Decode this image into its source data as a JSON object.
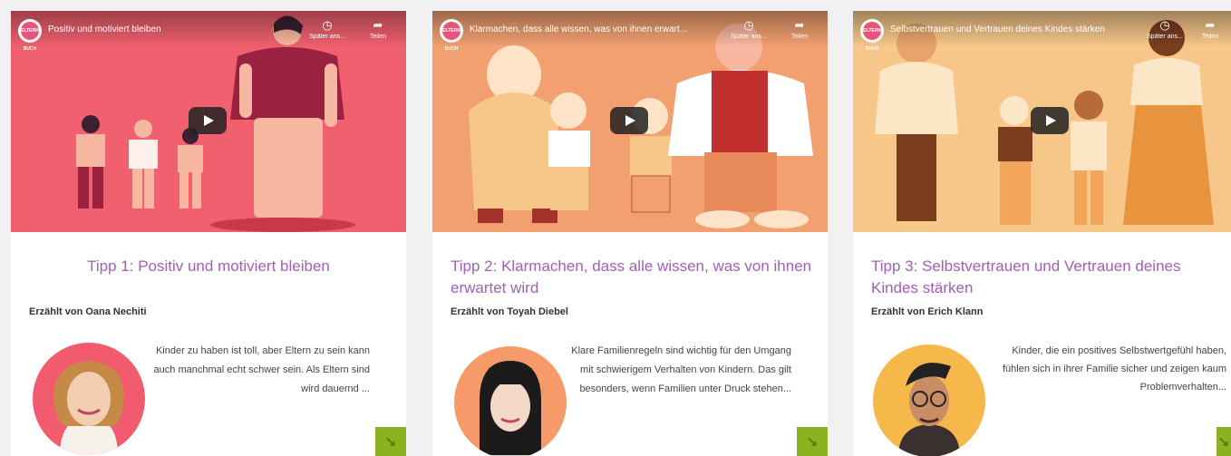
{
  "cards": [
    {
      "video": {
        "title": "Positiv und motiviert bleiben",
        "watch_later": "Später ans...",
        "share": "Teilen",
        "channel_badge": "ELTERN BUCH"
      },
      "title": "Tipp 1: Positiv und motiviert bleiben",
      "byline": "Erzählt von Oana Nechiti",
      "excerpt": "Kinder zu haben ist toll, aber Eltern zu sein kann auch manchmal echt schwer sein. Als Eltern sind wird dauernd ...",
      "colors": {
        "bg": "#f0606e",
        "avatar_bg": "#f25a6e"
      }
    },
    {
      "video": {
        "title": "Klarmachen, dass alle wissen, was von ihnen erwart...",
        "watch_later": "Später ans...",
        "share": "Teilen",
        "channel_badge": "ELTERN BUCH"
      },
      "title": "Tipp 2: Klarmachen, dass alle wissen, was von ihnen erwartet wird",
      "byline": "Erzählt von Toyah Diebel",
      "excerpt": "Klare Familienregeln sind wichtig für den Umgang mit schwierigem Verhalten von Kindern. Das gilt besonders, wenn Familien unter Druck stehen...",
      "colors": {
        "bg": "#f2a070",
        "avatar_bg": "#f79a6a"
      }
    },
    {
      "video": {
        "title": "Selbstvertrauen und Vertrauen deines Kindes stärken",
        "watch_later": "Später ans...",
        "share": "Teilen",
        "channel_badge": "ELTERN BUCH"
      },
      "title": "Tipp 3: Selbstvertrauen und Vertrauen deines Kindes stärken",
      "byline": "Erzählt von Erich Klann",
      "excerpt": "Kinder, die ein positives Selbstwertgefühl haben, fühlen sich in ihrer Familie sicher und zeigen kaum Problemverhalten...",
      "colors": {
        "bg": "#f7c78a",
        "avatar_bg": "#f6b84a"
      }
    }
  ],
  "icons": {
    "watch_later": "clock-icon",
    "share": "share-arrow-icon",
    "play": "play-icon",
    "more": "arrow-down-right-icon"
  }
}
